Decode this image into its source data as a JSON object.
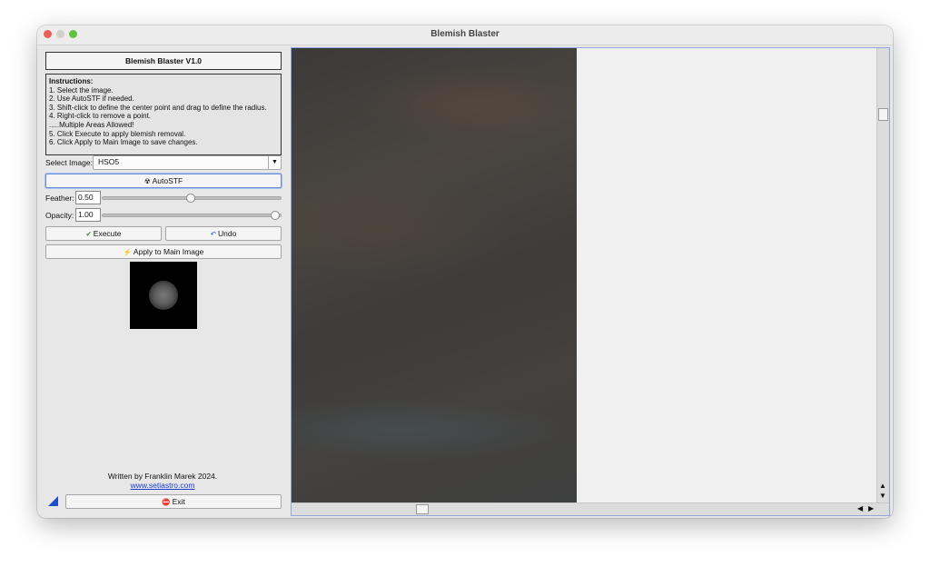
{
  "window": {
    "title": "Blemish Blaster"
  },
  "panel": {
    "title": "Blemish Blaster V1.0",
    "instructions": {
      "header": "Instructions:",
      "lines": [
        "1. Select the image.",
        "2. Use AutoSTF if needed.",
        "3. Shift-click to define the center point and drag to define the radius.",
        "4. Right-click to remove a point.",
        ".....Multiple Areas Allowed!",
        "5. Click Execute to apply blemish removal.",
        "6. Click Apply to Main Image to save changes."
      ]
    },
    "select_image": {
      "label": "Select Image:",
      "value": "HSO5"
    },
    "autostf_label": "AutoSTF",
    "feather": {
      "label": "Feather:",
      "value": "0.50",
      "level": 0.5
    },
    "opacity": {
      "label": "Opacity:",
      "value": "1.00",
      "level": 1.0
    },
    "execute_label": "Execute",
    "undo_label": "Undo",
    "apply_label": "Apply to Main Image",
    "credit": "Written by Franklin Marek 2024.",
    "link": "www.setiastro.com",
    "exit_label": "Exit"
  },
  "icons": {
    "close": "red-traffic-light",
    "minimize": "gray-traffic-light",
    "zoom": "green-traffic-light",
    "autostf": "radiation-icon",
    "execute": "checkmark-icon",
    "undo": "undo-arrow-icon",
    "apply": "lightning-icon",
    "exit": "stop-icon"
  },
  "colors": {
    "link": "#1a3fd0",
    "viewer_border": "#8ea6dc",
    "corner_triangle": "#1f4fc8"
  }
}
